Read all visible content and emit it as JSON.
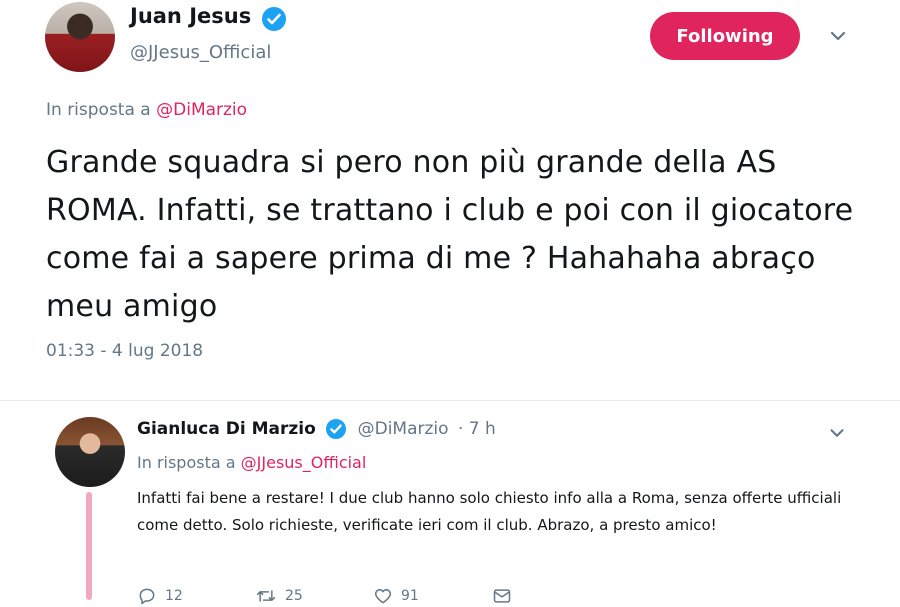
{
  "main_tweet": {
    "author_name": "Juan Jesus",
    "author_handle": "@JJesus_Official",
    "follow_button_label": "Following",
    "reply_to_prefix": "In risposta a",
    "reply_to_handle": "@DiMarzio",
    "text": "Grande squadra si pero non più grande della AS ROMA. Infatti, se trattano i club e poi con il giocatore come fai a sapere prima di me ? Hahahaha abraço meu amigo",
    "timestamp": "01:33 - 4 lug 2018"
  },
  "reply_tweet": {
    "author_name": "Gianluca Di Marzio",
    "author_handle": "@DiMarzio",
    "time_ago": "· 7 h",
    "reply_to_prefix": "In risposta a",
    "reply_to_handle": "@JJesus_Official",
    "text": "Infatti fai bene a restare! I due club hanno solo chiesto info alla a Roma, senza offerte ufficiali come detto. Solo richieste, verificate ieri com il club. Abrazo, a presto amico!",
    "actions": {
      "reply_count": "12",
      "retweet_count": "25",
      "like_count": "91"
    }
  },
  "colors": {
    "accent": "#e0245e",
    "verified": "#1da1f2",
    "muted_text": "#657786",
    "thread_line": "#f4a7c0"
  },
  "icons": [
    "verified-badge-icon",
    "chevron-down-icon",
    "reply-icon",
    "retweet-icon",
    "like-icon",
    "message-icon"
  ]
}
